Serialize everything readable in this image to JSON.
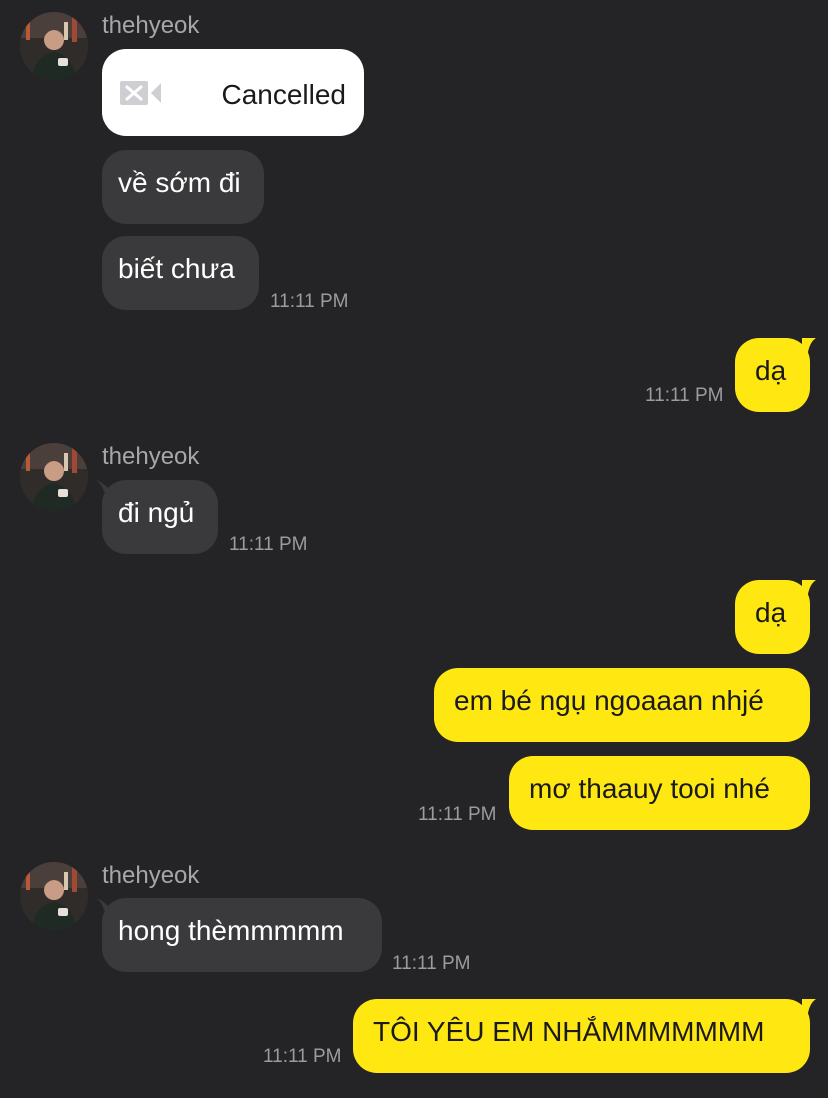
{
  "contact": {
    "name": "thehyeok"
  },
  "messages": {
    "group1": {
      "sender": "thehyeok",
      "call": {
        "status": "Cancelled",
        "icon": "video-call-cancelled-icon"
      },
      "texts": [
        "về sớm đi",
        "biết chưa"
      ],
      "time": "11:11 PM"
    },
    "reply1": {
      "texts": [
        "dạ"
      ],
      "time": "11:11 PM"
    },
    "group2": {
      "sender": "thehyeok",
      "texts": [
        "đi ngủ"
      ],
      "time": "11:11 PM"
    },
    "reply2": {
      "texts": [
        "dạ",
        "em bé ngụ ngoaaan nhjé",
        "mơ thaauy tooi nhé"
      ],
      "time": "11:11 PM"
    },
    "group3": {
      "sender": "thehyeok",
      "texts": [
        "hong thèmmmmm"
      ],
      "time": "11:11 PM"
    },
    "reply3": {
      "texts": [
        "TÔI YÊU EM NHẮMMMMMMM"
      ],
      "time": "11:11 PM"
    }
  },
  "colors": {
    "background": "#242426",
    "incoming_bubble": "#3a3a3c",
    "outgoing_bubble": "#ffe812",
    "timestamp": "#9b9ba0",
    "sender_name": "#a7a7ab"
  }
}
